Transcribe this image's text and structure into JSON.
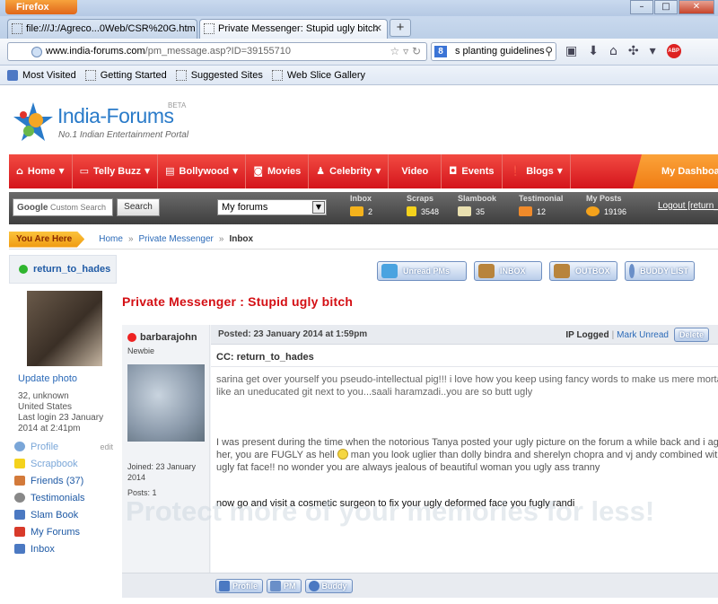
{
  "browser": {
    "app_button": "Firefox",
    "window_controls": [
      "–",
      "□",
      "✕"
    ],
    "tabs": [
      {
        "title": "file:///J:/Agreco...0Web/CSR%20G.htm",
        "active": false
      },
      {
        "title": "Private Messenger: Stupid ugly bitch",
        "active": true
      }
    ],
    "new_tab_label": "+",
    "url_domain": "www.india-forums.com",
    "url_path": "/pm_message.asp?ID=39155710",
    "search_value": "s planting guidelines",
    "search_engine_letter": "8",
    "bookmarks": [
      "Most Visited",
      "Getting Started",
      "Suggested Sites",
      "Web Slice Gallery"
    ],
    "abp_label": "ABP"
  },
  "site": {
    "logo_text": "India-Forums",
    "logo_beta": "BETA",
    "logo_tagline": "No.1 Indian Entertainment Portal",
    "nav": [
      {
        "label": "Home",
        "dropdown": true,
        "icon": "home-icon"
      },
      {
        "label": "Telly Buzz",
        "dropdown": true,
        "icon": "tv-icon"
      },
      {
        "label": "Bollywood",
        "dropdown": true,
        "icon": "film-icon"
      },
      {
        "label": "Movies",
        "dropdown": false,
        "icon": "camera-icon"
      },
      {
        "label": "Celebrity",
        "dropdown": true,
        "icon": "person-icon"
      },
      {
        "label": "Video",
        "dropdown": false,
        "icon": ""
      },
      {
        "label": "Events",
        "dropdown": false,
        "icon": "ticket-icon"
      },
      {
        "label": "Blogs",
        "dropdown": true,
        "icon": "exclaim-icon"
      }
    ],
    "dashboard_label": "My Dashboard",
    "google_brand": "Google",
    "google_placeholder": "Custom Search",
    "search_button": "Search",
    "forums_select": "My forums",
    "stats": [
      {
        "label": "Inbox",
        "value": "2",
        "color": "#f4b21c"
      },
      {
        "label": "Scraps",
        "value": "3548",
        "color": "#f4d21c"
      },
      {
        "label": "Slambook",
        "value": "35",
        "color": "#e9e0b0"
      },
      {
        "label": "Testimonial",
        "value": "12",
        "color": "#f08a2a"
      },
      {
        "label": "My Posts",
        "value": "19196",
        "color": "#f4a21c"
      }
    ],
    "logout_label": "Logout [return_to_hades]"
  },
  "breadcrumb": {
    "you_are_here": "You Are Here",
    "items": [
      "Home",
      "Private Messenger"
    ],
    "current": "Inbox",
    "separator": "»"
  },
  "sidebar": {
    "username": "return_to_hades",
    "update_photo": "Update photo",
    "info": [
      "32, unknown",
      "United States",
      "Last login 23 January",
      "2014 at 2:41pm"
    ],
    "edit_label": "edit",
    "menu": [
      {
        "label": "Profile",
        "color": "#7aa6d8",
        "icon": "profile-icon"
      },
      {
        "label": "Scrapbook",
        "color": "#f4d21c",
        "icon": "scrapbook-icon"
      },
      {
        "label": "Friends (37)",
        "color": "#d37a3a",
        "icon": "friends-icon"
      },
      {
        "label": "Testimonials",
        "color": "#888888",
        "icon": "testimonials-icon"
      },
      {
        "label": "Slam Book",
        "color": "#4b79c2",
        "icon": "slambook-icon"
      },
      {
        "label": "My Forums",
        "color": "#d83a2a",
        "icon": "forums-icon"
      },
      {
        "label": "Inbox",
        "color": "#4b79c2",
        "icon": "inbox-icon"
      }
    ]
  },
  "pm_buttons": [
    {
      "label": "Unread PMs",
      "icon_color": "#4aa3e0"
    },
    {
      "label": "INBOX",
      "icon_color": "#b8843c"
    },
    {
      "label": "OUTBOX",
      "icon_color": "#b8843c"
    },
    {
      "label": "BUDDY LIST",
      "icon_color": "#6a8fc8"
    }
  ],
  "pm_title": "Private Messenger : Stupid ugly bitch",
  "message": {
    "poster": "barbarajohn",
    "rank": "Newbie",
    "joined": "Joined: 23 January 2014",
    "posts": "Posts: 1",
    "posted": "Posted: 23 January 2014 at 1:59pm",
    "ip_logged": "IP Logged",
    "mark_unread": "Mark Unread",
    "delete_label": "Delete",
    "cc": "CC: return_to_hades",
    "p1_line1": "sarina get over yourself you pseudo-intellectual pig!!! i love how you keep using fancy words to make us mere mortals",
    "p1_line2": "like an uneducated git next to you...saali haramzadi..you are so butt ugly",
    "p2_line1": "I was present during the time when the notorious Tanya posted your ugly picture on the forum a while back and i agree with",
    "p2_line2a": "her, you are FUGLY as hell",
    "p2_line2b": " man you look uglier than dolly bindra and sherelyn chopra and vj andy combined with your",
    "p2_line3": "ugly fat face!! no wonder you are always jealous of beautiful woman you ugly ass tranny",
    "p3": "now go and visit a cosmetic surgeon to fix your ugly deformed face you fugly randi",
    "footer_buttons": [
      "Profile",
      "PM",
      "Buddy"
    ]
  },
  "watermark": "Protect more of your memories for less!"
}
